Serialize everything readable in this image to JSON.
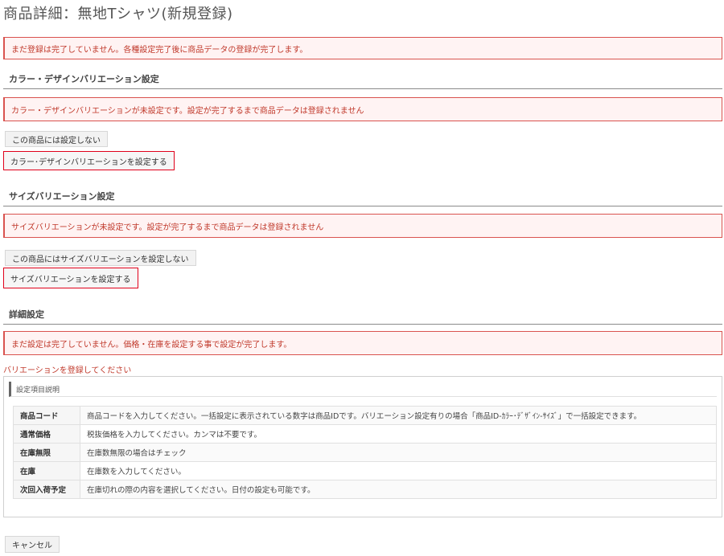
{
  "page": {
    "title": "商品詳細：無地Tシャツ(新規登録)"
  },
  "alerts": {
    "registration": "まだ登録は完了していません。各種設定完了後に商品データの登録が完了します。",
    "color_unset": "カラー・デザインバリエーションが未設定です。設定が完了するまで商品データは登録されません",
    "size_unset": "サイズバリエーションが未設定です。設定が完了するまで商品データは登録されません",
    "detail_incomplete": "まだ設定は完了していません。価格・在庫を設定する事で設定が完了します。"
  },
  "sections": {
    "color": {
      "heading": "カラー・デザインバリエーション設定",
      "skip_label": "この商品には設定しない",
      "set_label": "カラー･デザインバリエーションを設定する"
    },
    "size": {
      "heading": "サイズバリエーション設定",
      "skip_label": "この商品にはサイズバリエーションを設定しない",
      "set_label": "サイズバリエーションを設定する"
    },
    "detail": {
      "heading": "詳細設定"
    }
  },
  "notice": "バリエーションを登録してください",
  "help_panel": {
    "title": "設定項目説明",
    "rows": [
      {
        "key": "商品コード",
        "value": "商品コードを入力してください。一括設定に表示されている数字は商品IDです。バリエーション設定有りの場合「商品ID-ｶﾗｰ･ﾃﾞｻﾞｲﾝ-ｻｲｽﾞ」で一括設定できます。"
      },
      {
        "key": "通常価格",
        "value": "税抜価格を入力してください。カンマは不要です。"
      },
      {
        "key": "在庫無限",
        "value": "在庫数無限の場合はチェック"
      },
      {
        "key": "在庫",
        "value": "在庫数を入力してください。"
      },
      {
        "key": "次回入荷予定",
        "value": "在庫切れの際の内容を選択してください。日付の設定も可能です。"
      }
    ]
  },
  "footer": {
    "cancel_label": "キャンセル"
  },
  "colors": {
    "alert_border": "#d9534f",
    "alert_bg": "#fff3f3",
    "highlight": "#e0001a"
  }
}
